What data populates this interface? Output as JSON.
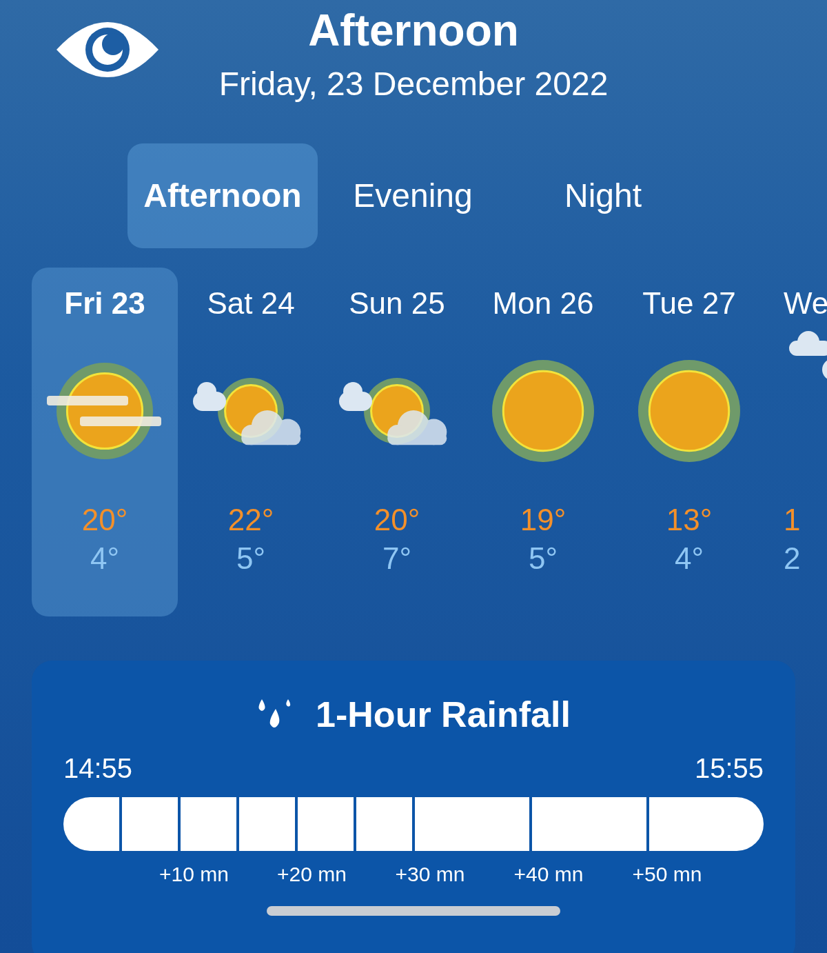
{
  "header": {
    "title": "Afternoon",
    "date": "Friday, 23 December 2022"
  },
  "tabs": [
    {
      "label": "Afternoon",
      "selected": true
    },
    {
      "label": "Evening",
      "selected": false
    },
    {
      "label": "Night",
      "selected": false
    }
  ],
  "days": [
    {
      "label": "Fri 23",
      "selected": true,
      "kind": "haze",
      "high": "20°",
      "low": "4°"
    },
    {
      "label": "Sat 24",
      "selected": false,
      "kind": "partly",
      "high": "22°",
      "low": "5°"
    },
    {
      "label": "Sun 25",
      "selected": false,
      "kind": "partly",
      "high": "20°",
      "low": "7°"
    },
    {
      "label": "Mon 26",
      "selected": false,
      "kind": "clear",
      "high": "19°",
      "low": "5°"
    },
    {
      "label": "Tue 27",
      "selected": false,
      "kind": "clear",
      "high": "13°",
      "low": "4°"
    },
    {
      "label": "We",
      "selected": false,
      "kind": "cloudy",
      "high": "1",
      "low": "2"
    }
  ],
  "rainfall": {
    "title": "1-Hour Rainfall",
    "start": "14:55",
    "end": "15:55",
    "ticks": [
      "+10 mn",
      "+20 mn",
      "+30 mn",
      "+40 mn",
      "+50 mn"
    ]
  }
}
